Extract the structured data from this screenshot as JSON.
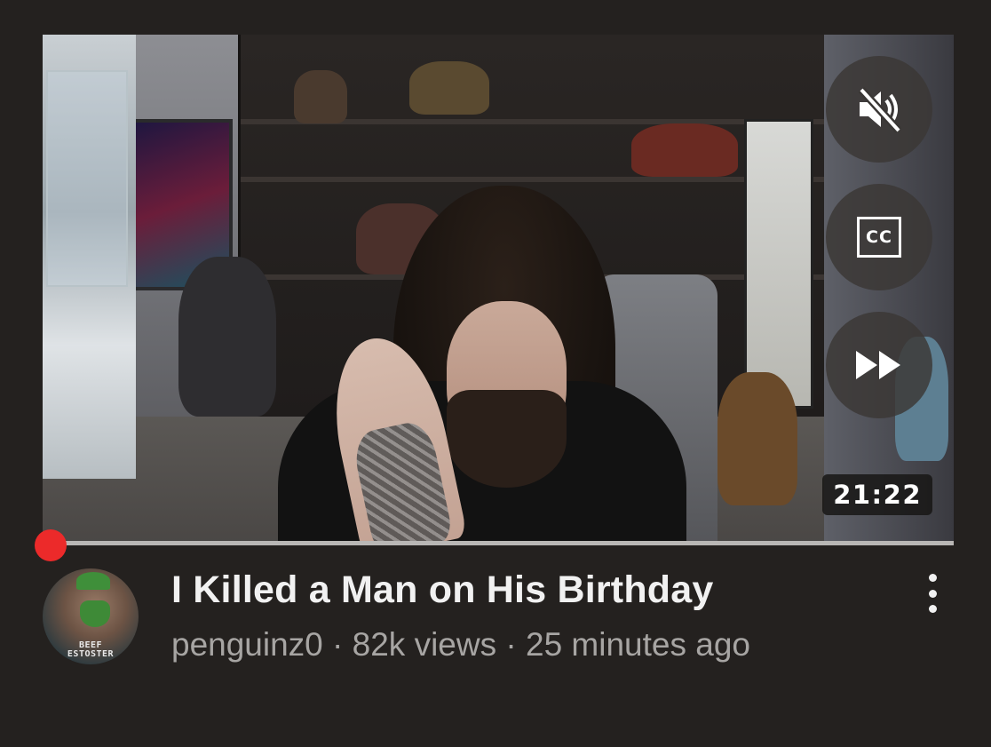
{
  "video": {
    "duration": "21:22",
    "progress": 0.0,
    "controls": {
      "mute_icon": "muted-speaker-icon",
      "cc_label": "CC",
      "fast_forward_icon": "fast-forward-icon"
    }
  },
  "channel": {
    "avatar_text_line1": "BEEF",
    "avatar_text_line2": "ESTOSTER"
  },
  "info": {
    "title": "I Killed a Man on His Birthday",
    "channel_name": "penguinz0",
    "views": "82k views",
    "age": "25 minutes ago",
    "separator": " · "
  },
  "colors": {
    "background": "#24211f",
    "progress_red": "#ec2a2a",
    "title_text": "#f1f1f1",
    "meta_text": "#a7a5a3"
  }
}
